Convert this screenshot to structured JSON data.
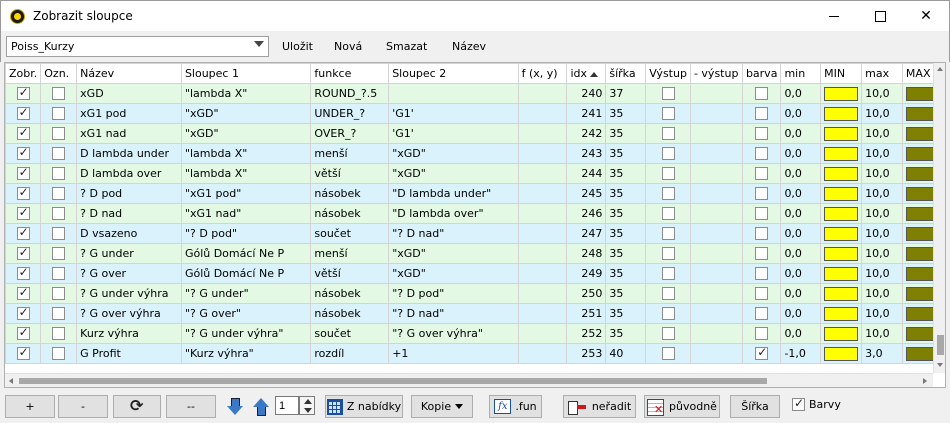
{
  "window": {
    "title": "Zobrazit sloupce",
    "close_glyph": "✕"
  },
  "toolbar": {
    "preset": "Poiss_Kurzy",
    "save": "Uložit",
    "new": "Nová",
    "delete": "Smazat",
    "name": "Název"
  },
  "columns": [
    "Zobr.",
    "Ozn.",
    "Název",
    "Sloupec 1",
    "funkce",
    "Sloupec 2",
    "f (x, y)",
    "idx",
    "šířka",
    "Výstup",
    "- výstup",
    "barva",
    "min",
    "MIN",
    "max",
    "MAX"
  ],
  "colors": {
    "min_swatch": "#ffff00",
    "max_swatch": "#808000",
    "row_even": "#e4f9e4",
    "row_odd": "#d9f2fb"
  },
  "rows": [
    {
      "zobr": true,
      "ozn": false,
      "nazev": "xGD",
      "s1": "\"lambda X\"",
      "funkce": "ROUND_?.5",
      "s2": "",
      "fxy": "",
      "idx": "240",
      "sirka": "37",
      "vystup": false,
      "barva": false,
      "min": "0,0",
      "max": "10,0"
    },
    {
      "zobr": true,
      "ozn": false,
      "nazev": "xG1 pod",
      "s1": "\"xGD\"",
      "funkce": "UNDER_?",
      "s2": "'G1'",
      "fxy": "",
      "idx": "241",
      "sirka": "35",
      "vystup": false,
      "barva": false,
      "min": "0,0",
      "max": "10,0"
    },
    {
      "zobr": true,
      "ozn": false,
      "nazev": "xG1 nad",
      "s1": "\"xGD\"",
      "funkce": "OVER_?",
      "s2": "'G1'",
      "fxy": "",
      "idx": "242",
      "sirka": "35",
      "vystup": false,
      "barva": false,
      "min": "0,0",
      "max": "10,0"
    },
    {
      "zobr": true,
      "ozn": false,
      "nazev": "D lambda under",
      "s1": "\"lambda X\"",
      "funkce": "menší",
      "s2": "\"xGD\"",
      "fxy": "",
      "idx": "243",
      "sirka": "35",
      "vystup": false,
      "barva": false,
      "min": "0,0",
      "max": "10,0"
    },
    {
      "zobr": true,
      "ozn": false,
      "nazev": "D lambda over",
      "s1": "\"lambda X\"",
      "funkce": "větší",
      "s2": "\"xGD\"",
      "fxy": "",
      "idx": "244",
      "sirka": "35",
      "vystup": false,
      "barva": false,
      "min": "0,0",
      "max": "10,0"
    },
    {
      "zobr": true,
      "ozn": false,
      "nazev": "? D pod",
      "s1": "\"xG1 pod\"",
      "funkce": "násobek",
      "s2": "\"D lambda under\"",
      "fxy": "",
      "idx": "245",
      "sirka": "35",
      "vystup": false,
      "barva": false,
      "min": "0,0",
      "max": "10,0"
    },
    {
      "zobr": true,
      "ozn": false,
      "nazev": "? D nad",
      "s1": "\"xG1 nad\"",
      "funkce": "násobek",
      "s2": "\"D lambda over\"",
      "fxy": "",
      "idx": "246",
      "sirka": "35",
      "vystup": false,
      "barva": false,
      "min": "0,0",
      "max": "10,0"
    },
    {
      "zobr": true,
      "ozn": false,
      "nazev": "D vsazeno",
      "s1": "\"? D pod\"",
      "funkce": "součet",
      "s2": "\"? D nad\"",
      "fxy": "",
      "idx": "247",
      "sirka": "35",
      "vystup": false,
      "barva": false,
      "min": "0,0",
      "max": "10,0"
    },
    {
      "zobr": true,
      "ozn": false,
      "nazev": "? G under",
      "s1": "Gólů Domácí Ne P",
      "funkce": "menší",
      "s2": "\"xGD\"",
      "fxy": "",
      "idx": "248",
      "sirka": "35",
      "vystup": false,
      "barva": false,
      "min": "0,0",
      "max": "10,0"
    },
    {
      "zobr": true,
      "ozn": false,
      "nazev": "? G over",
      "s1": "Gólů Domácí Ne P",
      "funkce": "větší",
      "s2": "\"xGD\"",
      "fxy": "",
      "idx": "249",
      "sirka": "35",
      "vystup": false,
      "barva": false,
      "min": "0,0",
      "max": "10,0"
    },
    {
      "zobr": true,
      "ozn": false,
      "nazev": "? G under výhra",
      "s1": "\"? G under\"",
      "funkce": "násobek",
      "s2": "\"? D pod\"",
      "fxy": "",
      "idx": "250",
      "sirka": "35",
      "vystup": false,
      "barva": false,
      "min": "0,0",
      "max": "10,0"
    },
    {
      "zobr": true,
      "ozn": false,
      "nazev": "? G over výhra",
      "s1": "\"? G over\"",
      "funkce": "násobek",
      "s2": "\"? D nad\"",
      "fxy": "",
      "idx": "251",
      "sirka": "35",
      "vystup": false,
      "barva": false,
      "min": "0,0",
      "max": "10,0"
    },
    {
      "zobr": true,
      "ozn": false,
      "nazev": "Kurz výhra",
      "s1": "\"? G under výhra\"",
      "funkce": "součet",
      "s2": "\"? G over výhra\"",
      "fxy": "",
      "idx": "252",
      "sirka": "35",
      "vystup": false,
      "barva": false,
      "min": "0,0",
      "max": "10,0"
    },
    {
      "zobr": true,
      "ozn": false,
      "nazev": "G Profit",
      "s1": "\"Kurz výhra\"",
      "funkce": "rozdíl",
      "s2": "+1",
      "fxy": "",
      "idx": "253",
      "sirka": "40",
      "vystup": false,
      "barva": true,
      "min": "-1,0",
      "max": "3,0"
    }
  ],
  "bottom": {
    "add": "+",
    "remove": "-",
    "clear": "--",
    "position": "1",
    "from_menu": "Z nabídky",
    "copy": "Kopie",
    "fun": ".fun",
    "unsort": "neřadit",
    "original": "původně",
    "width": "Šířka",
    "colors_label": "Barvy",
    "colors_checked": true
  }
}
